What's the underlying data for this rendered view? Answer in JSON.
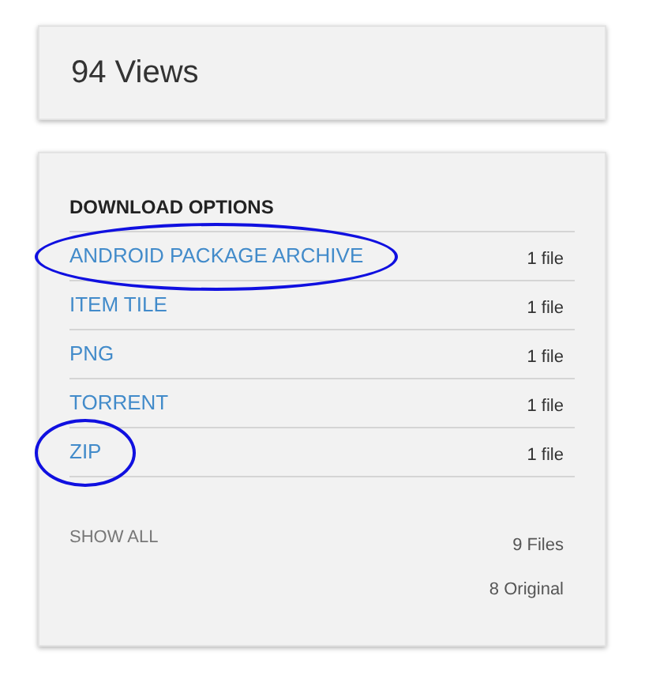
{
  "views": "94 Views",
  "download_options": {
    "title": "DOWNLOAD OPTIONS",
    "rows": [
      {
        "label": "ANDROID PACKAGE ARCHIVE",
        "count": "1 file",
        "circled": true
      },
      {
        "label": "ITEM TILE",
        "count": "1 file",
        "circled": false
      },
      {
        "label": "PNG",
        "count": "1 file",
        "circled": false
      },
      {
        "label": "TORRENT",
        "count": "1 file",
        "circled": false
      },
      {
        "label": "ZIP",
        "count": "1 file",
        "circled": true
      }
    ],
    "show_all": "SHOW ALL",
    "files": "9 Files",
    "original": "8 Original"
  }
}
